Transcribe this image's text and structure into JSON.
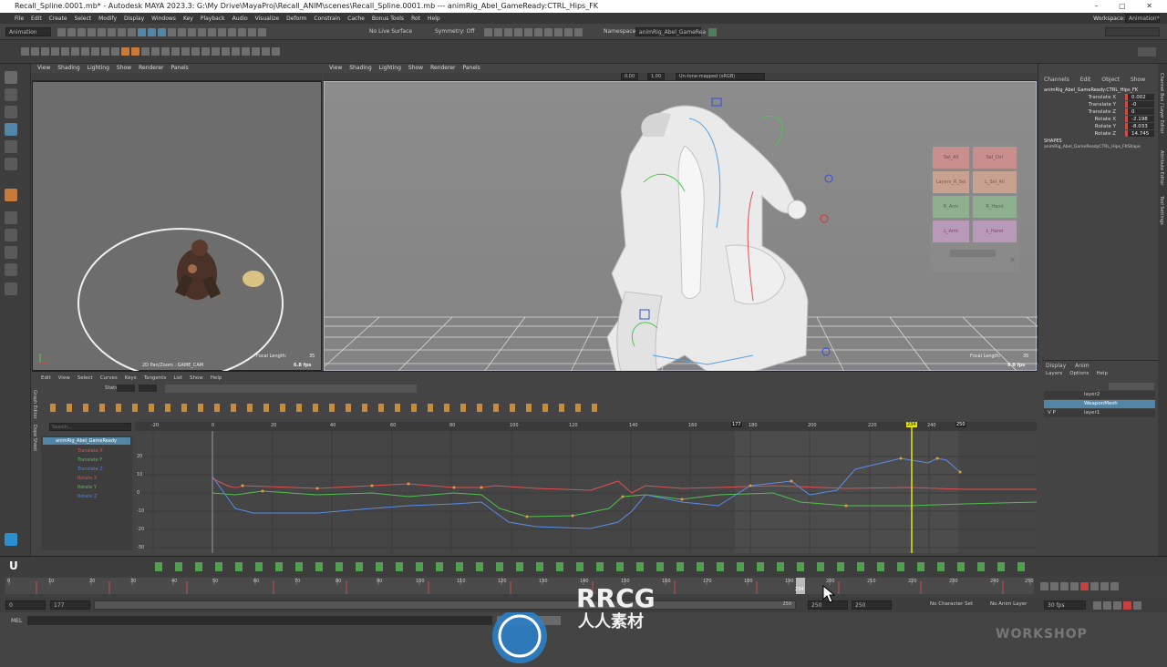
{
  "window_title": "Recall_Spline.0001.mb* - Autodesk MAYA 2023.3: G:\\My Drive\\MayaProj\\Recall_ANIM\\scenes\\Recall_Spline.0001.mb  ---  animRig_Abel_GameReady:CTRL_Hips_FK",
  "menus": [
    "File",
    "Edit",
    "Create",
    "Select",
    "Modify",
    "Display",
    "Windows",
    "Key",
    "Playback",
    "Audio",
    "Visualize",
    "Deform",
    "Constrain",
    "Cache",
    "Bonus Tools",
    "Rot",
    "Help"
  ],
  "workspace": {
    "label": "Workspace:",
    "value": "Animation*"
  },
  "status_line": {
    "mode": "Animation",
    "live_surface": "No Live Surface",
    "symmetry": "Symmetry: Off",
    "namespace_label": "Namespace:",
    "namespace_value": "animRig_Abel_GameRea"
  },
  "panel_menus": [
    "View",
    "Shading",
    "Lighting",
    "Show",
    "Renderer",
    "Panels"
  ],
  "left_viewport": {
    "hud_camera": "2D Pan/Zoom : GAME_CAM",
    "focal_label": "Focal Length:",
    "focal_value": "35",
    "fps": "6.8 fps"
  },
  "right_viewport": {
    "exposure": "0.00",
    "gamma": "1.00",
    "color_space": "Un-tone-mapped (sRGB)",
    "focal_label": "Focal Length:",
    "focal_value": "35",
    "fps": "6.8 fps"
  },
  "picker_labels": [
    "Sel_All",
    "Sel_Ctrl",
    "Layers_R_Sel",
    "L_Sel_All",
    "R_Arm",
    "R_Hand",
    "L_Arm",
    "L_Hand"
  ],
  "channel_box": {
    "tabs": [
      "Channels",
      "Edit",
      "Object",
      "Show"
    ],
    "object": "animRig_Abel_GameReady:CTRL_Hips_FK",
    "channels": [
      {
        "label": "Translate X",
        "value": "0.002"
      },
      {
        "label": "Translate Y",
        "value": "-0"
      },
      {
        "label": "Translate Z",
        "value": "0"
      },
      {
        "label": "Rotate X",
        "value": "-2.198"
      },
      {
        "label": "Rotate Y",
        "value": "-8.033"
      },
      {
        "label": "Rotate Z",
        "value": "14.745"
      }
    ],
    "shapes_label": "SHAPES",
    "shape": "animRig_Abel_GameReadyCTRL_Hips_FKShape"
  },
  "side_tabs": [
    "Channel Box / Layer Editor",
    "Attribute Editor",
    "Tool Settings"
  ],
  "layer_editor": {
    "tabs": [
      "Display",
      "Anim"
    ],
    "menus": [
      "Layers",
      "Options",
      "Help"
    ],
    "layers": [
      {
        "name": "layer2",
        "flags": ""
      },
      {
        "name": "WeaponMesh",
        "flags": "",
        "selected": true
      },
      {
        "name": "layer1",
        "flags": "V P"
      }
    ]
  },
  "graph_editor": {
    "menus": [
      "Edit",
      "View",
      "Select",
      "Curves",
      "Keys",
      "Tangents",
      "List",
      "Show",
      "Help"
    ],
    "stats_label": "Stats",
    "search_placeholder": "Search...",
    "side_tabs": [
      "Graph Editor",
      "Dope Sheet"
    ],
    "node": "animRig_Abel_GameReady",
    "curves": [
      {
        "name": "Translate X",
        "color": "#e05050"
      },
      {
        "name": "Translate Y",
        "color": "#50c050"
      },
      {
        "name": "Translate Z",
        "color": "#5080e0"
      },
      {
        "name": "Rotate X",
        "color": "#e05050"
      },
      {
        "name": "Rotate Y",
        "color": "#50c050"
      },
      {
        "name": "Rotate Z",
        "color": "#5080e0"
      }
    ],
    "frame_ticks": [
      "-20",
      "0",
      "20",
      "40",
      "60",
      "80",
      "100",
      "120",
      "140",
      "160",
      "177",
      "180",
      "200",
      "220",
      "234",
      "240",
      "250"
    ],
    "value_ticks": [
      "20",
      "10",
      "0",
      "-10",
      "-20",
      "-30"
    ],
    "current_frame": "234",
    "range_end": "250"
  },
  "timeslider": {
    "ticks": [
      "0",
      "10",
      "20",
      "30",
      "40",
      "50",
      "60",
      "70",
      "80",
      "90",
      "100",
      "110",
      "120",
      "130",
      "140",
      "150",
      "160",
      "170",
      "180",
      "190",
      "200",
      "210",
      "220",
      "230",
      "240",
      "250"
    ],
    "current": "234"
  },
  "range": {
    "start": "0",
    "inner_start": "177",
    "inner_end": "250",
    "end_a": "250",
    "end_b": "250",
    "character_set": "No Character Set",
    "anim_layer": "No Anim Layer",
    "fps": "30 fps"
  },
  "command_line": {
    "lang": "MEL",
    "result": "// Res"
  },
  "watermark": {
    "brand": "RRCG",
    "cn": "人人素材"
  },
  "workshop_watermark": "WORKSHOP",
  "accent_color": "#5285a6",
  "current_time_color": "#e6e600"
}
